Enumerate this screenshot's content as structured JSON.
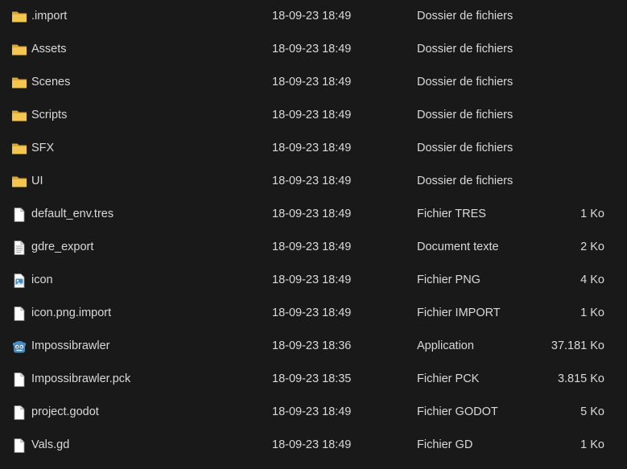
{
  "files": [
    {
      "name": ".import",
      "date": "18-09-23 18:49",
      "type": "Dossier de fichiers",
      "size": "",
      "icon": "folder-icon"
    },
    {
      "name": "Assets",
      "date": "18-09-23 18:49",
      "type": "Dossier de fichiers",
      "size": "",
      "icon": "folder-icon"
    },
    {
      "name": "Scenes",
      "date": "18-09-23 18:49",
      "type": "Dossier de fichiers",
      "size": "",
      "icon": "folder-icon"
    },
    {
      "name": "Scripts",
      "date": "18-09-23 18:49",
      "type": "Dossier de fichiers",
      "size": "",
      "icon": "folder-icon"
    },
    {
      "name": "SFX",
      "date": "18-09-23 18:49",
      "type": "Dossier de fichiers",
      "size": "",
      "icon": "folder-icon"
    },
    {
      "name": "UI",
      "date": "18-09-23 18:49",
      "type": "Dossier de fichiers",
      "size": "",
      "icon": "folder-icon"
    },
    {
      "name": "default_env.tres",
      "date": "18-09-23 18:49",
      "type": "Fichier TRES",
      "size": "1 Ko",
      "icon": "file-icon"
    },
    {
      "name": "gdre_export",
      "date": "18-09-23 18:49",
      "type": "Document texte",
      "size": "2 Ko",
      "icon": "text-file-icon"
    },
    {
      "name": "icon",
      "date": "18-09-23 18:49",
      "type": "Fichier PNG",
      "size": "4 Ko",
      "icon": "image-file-icon"
    },
    {
      "name": "icon.png.import",
      "date": "18-09-23 18:49",
      "type": "Fichier IMPORT",
      "size": "1 Ko",
      "icon": "file-icon"
    },
    {
      "name": "Impossibrawler",
      "date": "18-09-23 18:36",
      "type": "Application",
      "size": "37.181 Ko",
      "icon": "godot-app-icon"
    },
    {
      "name": "Impossibrawler.pck",
      "date": "18-09-23 18:35",
      "type": "Fichier PCK",
      "size": "3.815 Ko",
      "icon": "file-icon"
    },
    {
      "name": "project.godot",
      "date": "18-09-23 18:49",
      "type": "Fichier GODOT",
      "size": "5 Ko",
      "icon": "file-icon"
    },
    {
      "name": "Vals.gd",
      "date": "18-09-23 18:49",
      "type": "Fichier GD",
      "size": "1 Ko",
      "icon": "file-icon"
    }
  ],
  "colors": {
    "background": "#191919",
    "text": "#d9d9d9",
    "folder": "#f4c54f",
    "folder_dark": "#dca733",
    "godot_blue": "#478cbf"
  }
}
